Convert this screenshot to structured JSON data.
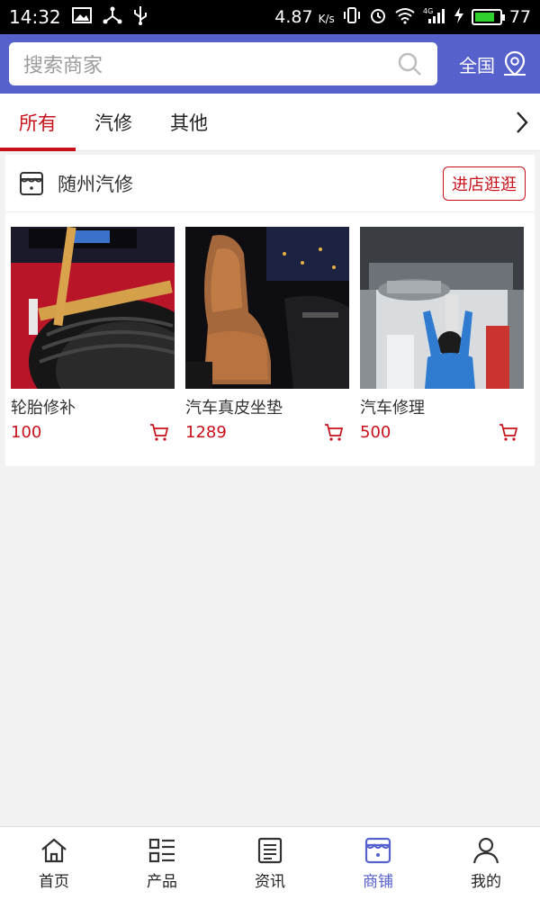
{
  "statusbar": {
    "time": "14:32",
    "speed": "4.87",
    "speed_unit": "K/s",
    "battery": "77",
    "icons": [
      "image-icon",
      "share-icon",
      "usb-icon",
      "vibrate-icon",
      "alarm-icon",
      "wifi-icon",
      "signal-4g-icon",
      "charging-icon",
      "battery-icon"
    ]
  },
  "header": {
    "search_placeholder": "搜索商家",
    "region_label": "全国",
    "accent": "#5661cc"
  },
  "tabs": {
    "items": [
      "所有",
      "汽修",
      "其他"
    ],
    "active_index": 0,
    "active_color": "#c7101a"
  },
  "store": {
    "name": "随州汽修",
    "enter_label": "进店逛逛",
    "products": [
      {
        "name": "轮胎修补",
        "price": "100"
      },
      {
        "name": "汽车真皮坐垫",
        "price": "1289"
      },
      {
        "name": "汽车修理",
        "price": "500"
      }
    ]
  },
  "bottom_nav": {
    "items": [
      "首页",
      "产品",
      "资讯",
      "商铺",
      "我的"
    ],
    "active_index": 3
  }
}
